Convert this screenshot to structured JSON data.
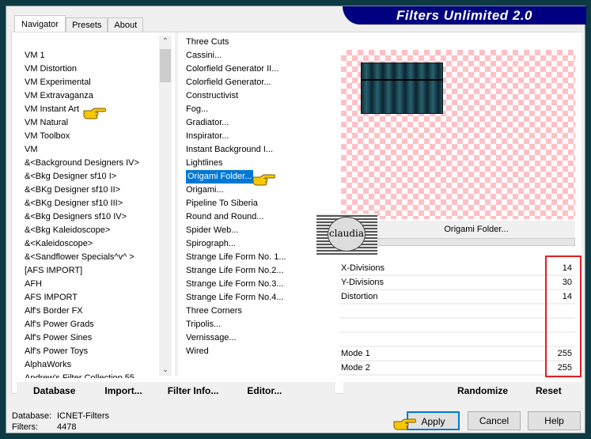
{
  "app": {
    "title": "Filters Unlimited 2.0"
  },
  "tabs": [
    {
      "label": "Navigator"
    },
    {
      "label": "Presets"
    },
    {
      "label": "About"
    }
  ],
  "categories": [
    "VM 1",
    "VM Distortion",
    "VM Experimental",
    "VM Extravaganza",
    "VM Instant Art",
    "VM Natural",
    "VM Toolbox",
    "VM",
    "&<Background Designers IV>",
    "&<Bkg Designer sf10 I>",
    "&<BKg Designer sf10 II>",
    "&<BKg Designer sf10 III>",
    "&<Bkg Designers sf10 IV>",
    "&<Bkg Kaleidoscope>",
    "&<Kaleidoscope>",
    "&<Sandflower Specials^v^ >",
    "[AFS IMPORT]",
    "AFH",
    "AFS IMPORT",
    "Alf's Border FX",
    "Alf's Power Grads",
    "Alf's Power Sines",
    "Alf's Power Toys",
    "AlphaWorks",
    "Andrew's Filter Collection 55"
  ],
  "selected_category": "VM Instant Art",
  "filters": [
    "Three Cuts",
    "Cassini...",
    "Colorfield Generator II...",
    "Colorfield Generator...",
    "Constructivist",
    "Fog...",
    "Gradiator...",
    "Inspirator...",
    "Instant Background I...",
    "Lightlines",
    "Origami Folder...",
    "Origami...",
    "Pipeline To Siberia",
    "Round and Round...",
    "Spider Web...",
    "Spirograph...",
    "Strange Life Form No. 1...",
    "Strange Life Form No.2...",
    "Strange Life Form No.3...",
    "Strange Life Form No.4...",
    "Three Corners",
    "Tripolis...",
    "Vernissage...",
    "Wired"
  ],
  "selected_filter": "Origami Folder...",
  "preview": {
    "filter_name": "Origami Folder...",
    "watermark": "claudia"
  },
  "params": [
    {
      "label": "X-Divisions",
      "value": "14"
    },
    {
      "label": "Y-Divisions",
      "value": "30"
    },
    {
      "label": "Distortion",
      "value": "14"
    },
    {
      "label": "",
      "value": ""
    },
    {
      "label": "",
      "value": ""
    },
    {
      "label": "",
      "value": ""
    },
    {
      "label": "Mode 1",
      "value": "255"
    },
    {
      "label": "Mode 2",
      "value": "255"
    }
  ],
  "toolbar": {
    "database": "Database",
    "import": "Import...",
    "filter_info": "Filter Info...",
    "editor": "Editor...",
    "randomize": "Randomize",
    "reset": "Reset"
  },
  "status": {
    "database_label": "Database:",
    "database_value": "ICNET-Filters",
    "filters_label": "Filters:",
    "filters_value": "4478"
  },
  "buttons": {
    "apply": "Apply",
    "cancel": "Cancel",
    "help": "Help"
  },
  "colors": {
    "banner": "#000080",
    "selection": "#0078d7",
    "highlight_box": "#e02020",
    "checker": "#ffc0c6"
  }
}
